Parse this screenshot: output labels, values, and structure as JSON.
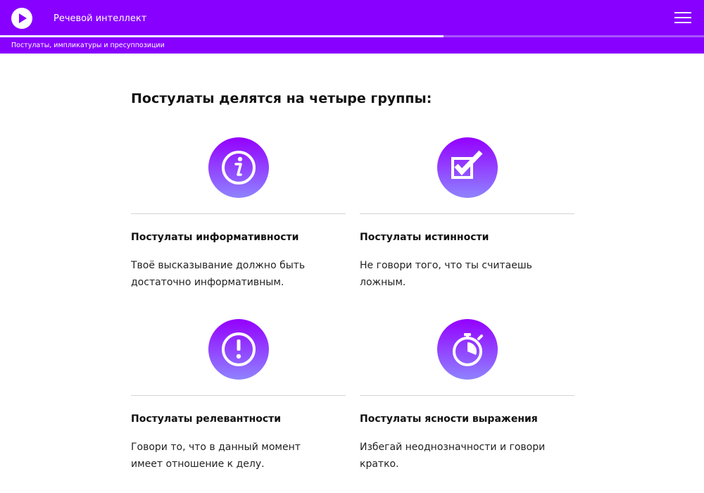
{
  "header": {
    "course_title": "Речевой интеллект",
    "lesson_title": "Постулаты, импликатуры и пресуппозиции",
    "progress_percent": 63,
    "colors": {
      "bar": "#8800ff",
      "progress_track": "#a855ff",
      "progress_fill": "#ffffff"
    },
    "icons": {
      "play": "play-icon",
      "menu": "hamburger-menu-icon"
    }
  },
  "main": {
    "heading": "Постулаты делятся на четыре группы:",
    "cards": [
      {
        "icon": "info-icon",
        "title": "Постулаты информативности",
        "text": "Твоё высказывание должно быть достаточно информативным."
      },
      {
        "icon": "checkbox-checked-icon",
        "title": "Постулаты истинности",
        "text": "Не говори того, что ты считаешь ложным."
      },
      {
        "icon": "exclamation-icon",
        "title": "Постулаты релевантности",
        "text": "Говори то, что в данный момент имеет отношение к делу."
      },
      {
        "icon": "stopwatch-icon",
        "title": "Постулаты ясности выражения",
        "text": "Избегай неоднозначности и говори кратко."
      }
    ],
    "icon_gradient": [
      "#9400ff",
      "#8f83ff"
    ]
  }
}
